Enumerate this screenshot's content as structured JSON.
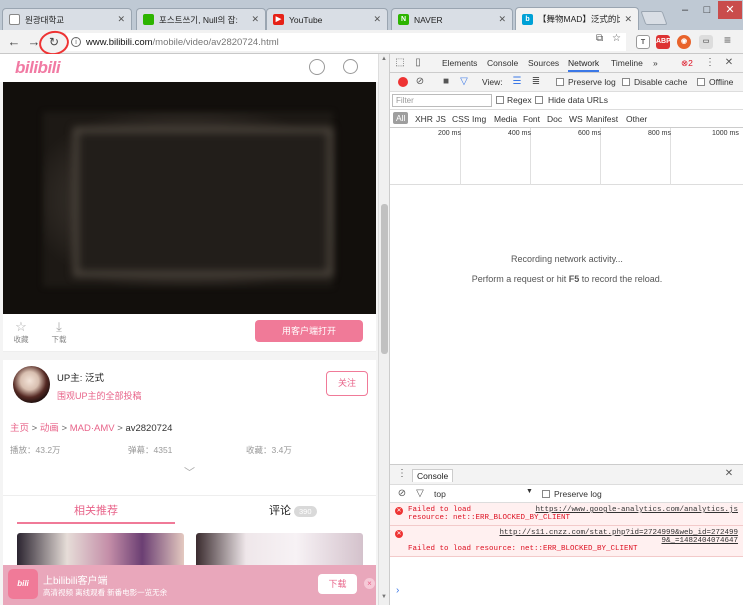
{
  "browser": {
    "tabs": [
      {
        "title": "원광대학교",
        "favicon": "page",
        "color": "#999999"
      },
      {
        "title": "포스트쓰기, Null의 잡:",
        "favicon": "blog",
        "color": "#2db400"
      },
      {
        "title": "YouTube",
        "favicon": "yt",
        "color": "#e62117"
      },
      {
        "title": "NAVER",
        "favicon": "N",
        "color": "#2db400"
      },
      {
        "title": "【舞物MAD】泛式的比:",
        "favicon": "bili",
        "color": "#00a1d6"
      }
    ],
    "url_host": "www.bilibili.com",
    "url_path": "/mobile/video/av2820724.html",
    "window_controls": [
      "–",
      "□",
      "✕"
    ]
  },
  "page": {
    "logo": "bilibili",
    "action_favorite": "收藏",
    "action_download": "下载",
    "open_in_app": "用客户端打开",
    "uploader_name": "UP主: 泛式",
    "uploader_sub": "围观UP主的全部投稿",
    "follow": "关注",
    "breadcrumb": [
      "主页",
      ">",
      "动画",
      ">",
      "MAD·AMV",
      ">",
      "av2820724"
    ],
    "stats": [
      "播放：43.2万",
      "弹幕：4351",
      "收藏：3.4万"
    ],
    "tab_related": "相关推荐",
    "tab_comments": "评论",
    "comments_count": "390",
    "promo_logo": "bili",
    "promo_title": "上bilibili客户端",
    "promo_sub": "高清视频 离线观看 新番电影一览无余",
    "promo_download": "下载",
    "promo_close": "×"
  },
  "devtools": {
    "tabs": [
      "Elements",
      "Console",
      "Sources",
      "Network",
      "Timeline"
    ],
    "active_tab": "Network",
    "more": "»",
    "error_count": "2",
    "view_label": "View:",
    "preserve_log": "Preserve log",
    "disable_cache": "Disable cache",
    "offline": "Offline",
    "filter_placeholder": "Filter",
    "regex": "Regex",
    "hide_data_urls": "Hide data URLs",
    "types": [
      "All",
      "XHR",
      "JS",
      "CSS",
      "Img",
      "Media",
      "Font",
      "Doc",
      "WS",
      "Manifest",
      "Other"
    ],
    "timeline_ticks": [
      "200 ms",
      "400 ms",
      "600 ms",
      "800 ms",
      "1000 ms"
    ],
    "empty_line1": "Recording network activity...",
    "empty_line2_pre": "Perform a request or hit ",
    "empty_line2_key": "F5",
    "empty_line2_post": " to record the reload.",
    "console_tab": "Console",
    "console_context": "top",
    "console_preserve": "Preserve log",
    "errors": [
      {
        "pre": "Failed to load",
        "link": "https://www.google-analytics.com/analytics.js",
        "post": "resource: net::ERR_BLOCKED_BY_CLIENT"
      },
      {
        "pre": "",
        "link": "http://s11.cnzz.com/stat.php?id=2724999&web_id=2724999&_=1482404074647",
        "post": "Failed to load resource: net::ERR_BLOCKED_BY_CLIENT"
      }
    ],
    "prompt": "›"
  },
  "colors": {
    "accent": "#f07a98",
    "devtools_accent": "#3b78e7",
    "error": "#dd1122"
  }
}
